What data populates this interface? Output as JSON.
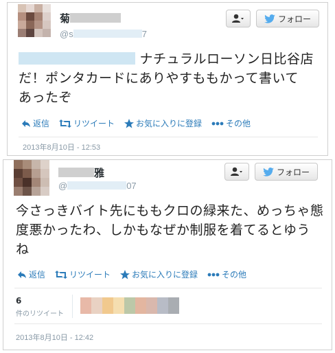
{
  "tweets": [
    {
      "display_name": "菊",
      "handle_prefix": "@s",
      "handle_suffix": "7",
      "text": "ナチュラルローソン日比谷店だ！ポンタカードにありやすももかって書いてあったぞ",
      "text_line1": "ナチュラルローソン日比谷店",
      "text_line2": "だ！ポンタカードにありやすももかって書いて",
      "text_line3": "あったぞ",
      "actions": {
        "reply": "返信",
        "retweet": "リツイート",
        "favorite": "お気に入りに登録",
        "more": "その他"
      },
      "follow_label": "フォロー",
      "timestamp": "2013年8月10日 - 12:53"
    },
    {
      "display_name": "雅",
      "handle_prefix": "@",
      "handle_suffix": "07",
      "text": "今さっきバイト先にももクロの緑来た、めっちゃ態度悪かったわ、しかもなぜか制服を着てるとゆうね",
      "text_line1": "今さっきバイト先にももクロの緑来た、めっちゃ態",
      "text_line2": "度悪かったわ、しかもなぜか制服を着てるとゆう",
      "text_line3": "ね",
      "actions": {
        "reply": "返信",
        "retweet": "リツイート",
        "favorite": "お気に入りに登録",
        "more": "その他"
      },
      "follow_label": "フォロー",
      "retweet_count": "6",
      "retweet_count_label": "件のリツイート",
      "timestamp": "2013年8月10日 - 12:42"
    }
  ],
  "icons": [
    "person-icon",
    "chevron-down-icon",
    "twitter-bird-icon",
    "reply-icon",
    "retweet-icon",
    "star-icon",
    "more-dots-icon"
  ],
  "colors": {
    "link": "#2b7bb9",
    "bird": "#55acee",
    "muted": "#8899a6"
  }
}
